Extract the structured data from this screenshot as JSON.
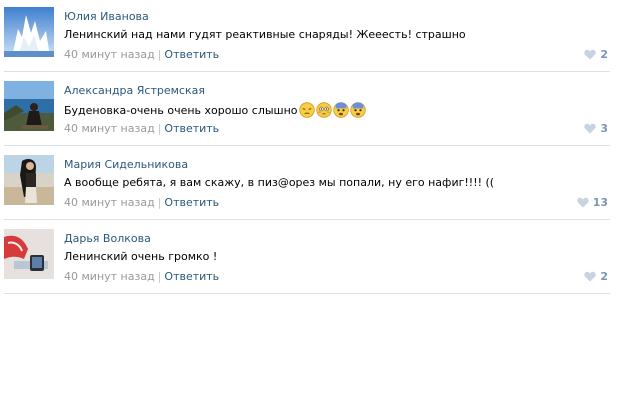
{
  "comments": [
    {
      "author": "Юлия Иванова",
      "text": "Ленинский над нами гудят реактивные снаряды! Жееесть! страшно",
      "time": "40 минут назад",
      "reply_label": "Ответить",
      "likes": "2",
      "emojis": []
    },
    {
      "author": "Александра Ястремская",
      "text": "Буденовка-очень очень хорошо слышно",
      "time": "40 минут назад",
      "reply_label": "Ответить",
      "likes": "3",
      "emojis": [
        "pensive-face-icon",
        "flushed-face-icon",
        "fearful-face-icon",
        "fearful-face-icon"
      ]
    },
    {
      "author": "Мария Сидельникова",
      "text": "А вообще ребята, я вам скажу, в пиз@орез мы попали, ну его нафиг!!!! ((",
      "time": "40 минут назад",
      "reply_label": "Ответить",
      "likes": "13",
      "emojis": []
    },
    {
      "author": "Дарья Волкова",
      "text": "Ленинский очень громко !",
      "time": "40 минут назад",
      "reply_label": "Ответить",
      "likes": "2",
      "emojis": []
    }
  ],
  "colors": {
    "link": "#2b587a",
    "muted": "#999999",
    "like": "#7a96b4",
    "divider": "#dae1e8"
  }
}
